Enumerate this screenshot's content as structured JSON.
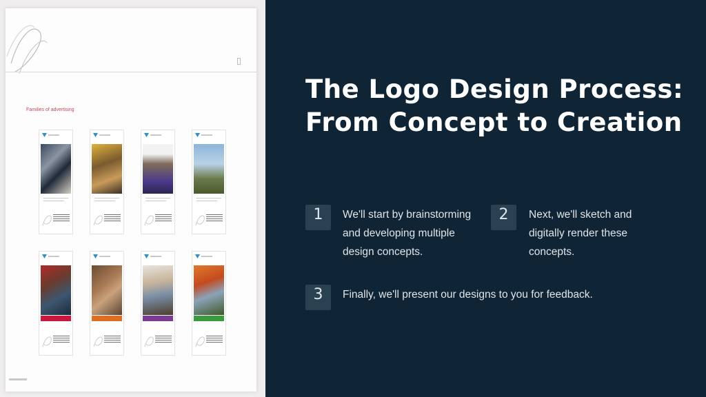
{
  "slide": {
    "title": "The Logo Design Process: From Concept to Creation",
    "steps": [
      {
        "number": "1",
        "text": "We'll start by brainstorming and developing multiple design concepts."
      },
      {
        "number": "2",
        "text": "Next, we'll sketch and digitally render these concepts."
      },
      {
        "number": "3",
        "text": "Finally, we'll present our designs to you for feedback."
      }
    ]
  },
  "document_preview": {
    "heading": "Families of advertising",
    "band_colors": [
      "#c8163c",
      "#de6e22",
      "#7d3a93",
      "#3a9a3d"
    ]
  },
  "colors": {
    "background": "#0f2535",
    "number_box": "#2a4152",
    "title": "#ffffff",
    "body_text": "#dfe5ea"
  }
}
